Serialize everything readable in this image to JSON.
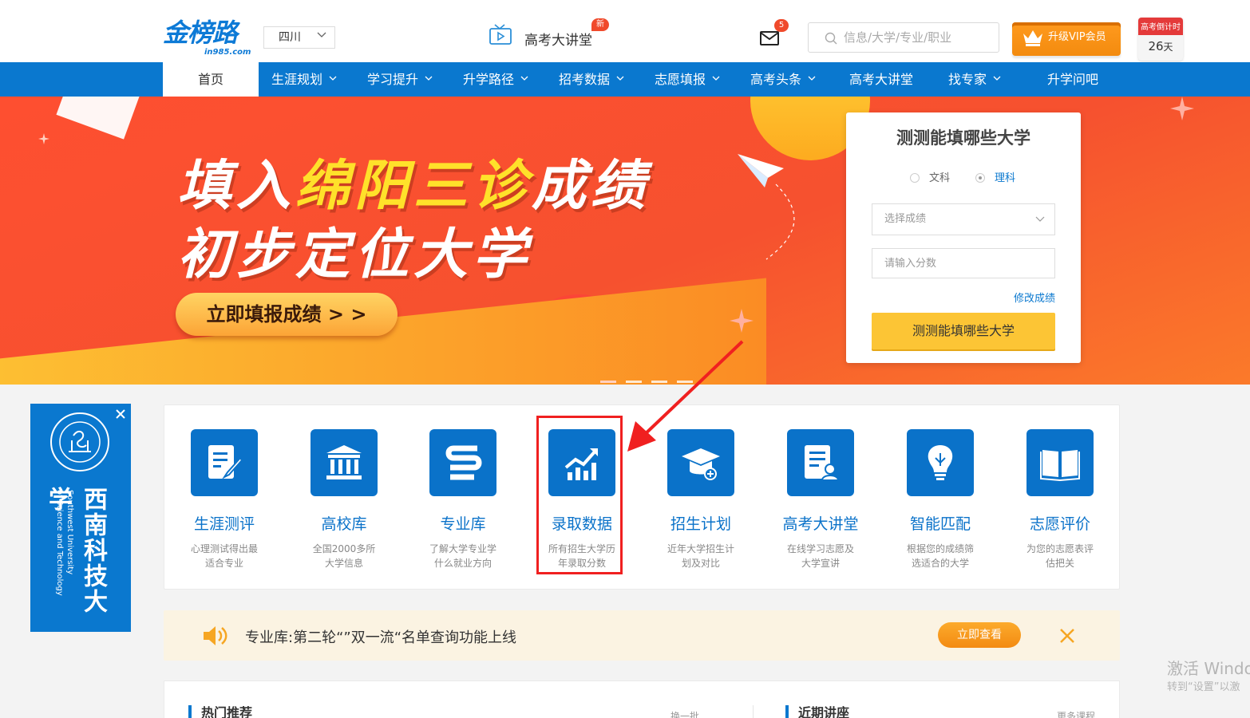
{
  "header": {
    "logo": "金榜路",
    "logo_sub": "in985.com",
    "region": "四川",
    "lecture_label": "高考大讲堂",
    "new_badge": "新",
    "mail_count": "5",
    "search_placeholder": "信息/大学/专业/职业",
    "vip_label": "升级VIP会员",
    "countdown_label": "高考倒计时",
    "countdown_value": "26",
    "countdown_unit": "天"
  },
  "nav": {
    "items": [
      {
        "label": "首页"
      },
      {
        "label": "生涯规划"
      },
      {
        "label": "学习提升"
      },
      {
        "label": "升学路径"
      },
      {
        "label": "招考数据"
      },
      {
        "label": "志愿填报"
      },
      {
        "label": "高考头条"
      },
      {
        "label": "高考大讲堂"
      },
      {
        "label": "找专家"
      },
      {
        "label": "升学问吧"
      }
    ]
  },
  "banner": {
    "line1_a": "填入",
    "line1_b": "绵阳三诊",
    "line1_c": "成绩",
    "line2": "初步定位大学",
    "button": "立即填报成绩 > >"
  },
  "quiz": {
    "title": "测测能填哪些大学",
    "radio_arts": "文科",
    "radio_science": "理科",
    "select_placeholder": "选择成绩",
    "input_placeholder": "请输入分数",
    "edit_link": "修改成绩",
    "submit": "测测能填哪些大学"
  },
  "side_ad": {
    "name_cn": "西南科技大学",
    "name_en_1": "Southwest University",
    "name_en_2": "of Science and Technology"
  },
  "features": [
    {
      "title": "生涯测评",
      "desc": "心理测试得出最适合专业",
      "icon": "edit-document-icon"
    },
    {
      "title": "高校库",
      "desc": "全国2000多所大学信息",
      "icon": "university-icon"
    },
    {
      "title": "专业库",
      "desc": "了解大学专业学什么就业方向",
      "icon": "major-books-icon"
    },
    {
      "title": "录取数据",
      "desc": "所有招生大学历年录取分数",
      "icon": "trend-chart-icon"
    },
    {
      "title": "招生计划",
      "desc": "近年大学招生计划及对比",
      "icon": "graduation-cap-icon"
    },
    {
      "title": "高考大讲堂",
      "desc": "在线学习志愿及大学宣讲",
      "icon": "lecture-doc-icon"
    },
    {
      "title": "智能匹配",
      "desc": "根据您的成绩筛选适合的大学",
      "icon": "lightbulb-icon"
    },
    {
      "title": "志愿评价",
      "desc": "为您的志愿表评估把关",
      "icon": "open-book-icon"
    }
  ],
  "notice": {
    "text": "专业库:第二轮“”双一流“名单查询功能上线",
    "button": "立即查看"
  },
  "bottom": {
    "hot": "热门推荐",
    "batch": "换一批",
    "recent": "近期讲座",
    "more": "更多课程"
  },
  "watermark": {
    "line1": "激活 Windo",
    "line2": "转到“设置”以激"
  },
  "colors": {
    "primary": "#0a78cf",
    "accent": "#fcc535",
    "banner": "#f6512f",
    "highlight": "#f02020"
  }
}
